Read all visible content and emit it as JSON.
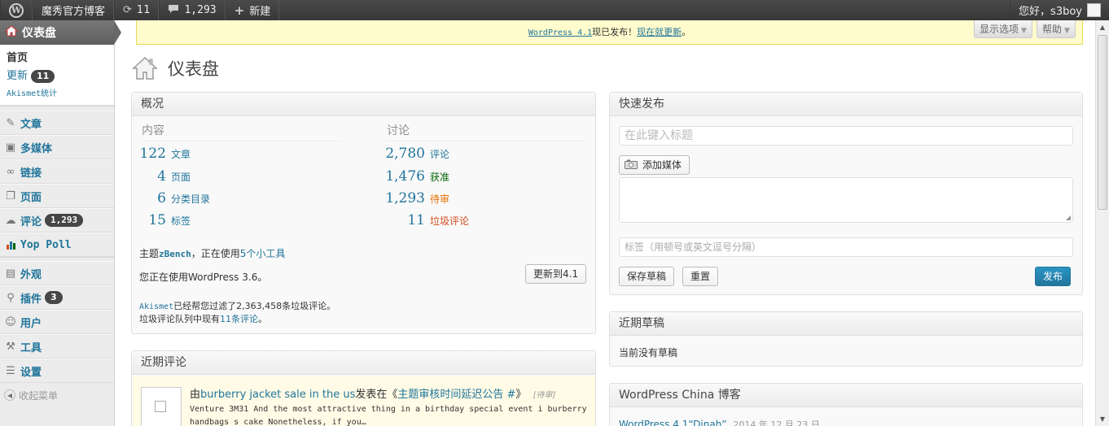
{
  "adminbar": {
    "site_name": "魔秀官方博客",
    "updates_count": "11",
    "comments_count": "1,293",
    "new_label": "新建",
    "greeting": "您好，s3boy"
  },
  "menu": {
    "dashboard": "仪表盘",
    "sub": {
      "home": "首页",
      "updates": "更新",
      "updates_count": "11",
      "akismet": "Akismet统计"
    },
    "items": [
      {
        "label": "文章",
        "icon": "pushpin-icon"
      },
      {
        "label": "多媒体",
        "icon": "media-icon"
      },
      {
        "label": "链接",
        "icon": "links-icon"
      },
      {
        "label": "页面",
        "icon": "pages-icon"
      },
      {
        "label": "评论",
        "icon": "comments-icon",
        "badge": "1,293"
      },
      {
        "label": "Yop Poll",
        "icon": "poll-icon"
      },
      {
        "label": "外观",
        "icon": "appearance-icon"
      },
      {
        "label": "插件",
        "icon": "plugins-icon",
        "badge": "3"
      },
      {
        "label": "用户",
        "icon": "users-icon"
      },
      {
        "label": "工具",
        "icon": "tools-icon"
      },
      {
        "label": "设置",
        "icon": "settings-icon"
      }
    ],
    "collapse": "收起菜单"
  },
  "notice": {
    "link1": "WordPress 4.1",
    "text": "现已发布！",
    "link2": "现在就更新",
    "end": "。"
  },
  "screen_options": "显示选项",
  "help": "帮助",
  "page_title": "仪表盘",
  "overview": {
    "title": "概况",
    "content_head": "内容",
    "discussion_head": "讨论",
    "content": [
      {
        "num": "122",
        "label": "文章"
      },
      {
        "num": "4",
        "label": "页面"
      },
      {
        "num": "6",
        "label": "分类目录"
      },
      {
        "num": "15",
        "label": "标签"
      }
    ],
    "discussion": [
      {
        "num": "2,780",
        "label": "评论",
        "color": "#21759b"
      },
      {
        "num": "1,476",
        "label": "获准",
        "color": "#006505"
      },
      {
        "num": "1,293",
        "label": "待审",
        "color": "#e66f00"
      },
      {
        "num": "11",
        "label": "垃圾评论",
        "color": "#d54e21"
      }
    ],
    "theme_pre": "主题",
    "theme_name": "zBench",
    "theme_mid": "，正在使用",
    "widgets": "5个小工具",
    "version_text": "您正在使用WordPress 3.6。",
    "update_btn": "更新到4.1",
    "akismet_link": "Akismet",
    "akismet_text": "已经帮您过滤了2,363,458条垃圾评论。",
    "queue_pre": "垃圾评论队列中现有",
    "queue_link": "11条评论",
    "queue_end": "。"
  },
  "recent_comments": {
    "title": "近期评论",
    "by": "由",
    "author": "burberry jacket sale in the us",
    "on": "发表在《",
    "post": "主题审核时间延迟公告 #",
    "close": "》",
    "status": "[待审]",
    "excerpt1": "Venture 3M31 And the most attractive thing in a birthday special event i burberry",
    "excerpt2": "handbags s cake Nonetheless, if you…"
  },
  "quick_press": {
    "title": "快速发布",
    "title_placeholder": "在此键入标题",
    "add_media": "添加媒体",
    "tags_placeholder": "标签（用顿号或英文逗号分隔）",
    "save_draft": "保存草稿",
    "reset": "重置",
    "publish": "发布"
  },
  "recent_drafts": {
    "title": "近期草稿",
    "empty": "当前没有草稿"
  },
  "wp_china": {
    "title": "WordPress China 博客",
    "item": "WordPress 4.1“Dinah”",
    "date": "2014 年 12 月 23 日"
  }
}
